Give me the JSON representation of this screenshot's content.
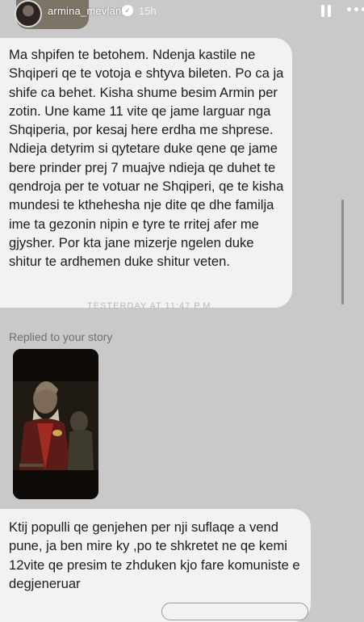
{
  "header": {
    "username": "armina_mevlani",
    "verified_mark": "✓",
    "time": "15h",
    "pause_icon": "pause-icon",
    "more_icon": "more-icon"
  },
  "messages": [
    {
      "text": "Ma shpifen te betohem. Ndenja kastile ne Shqiperi qe te votoja e shtyva bileten. Po ca ja shife ca behet. Kisha shume besim Armin per zotin. Une kame 11 vite qe jame larguar nga Shqiperia, por kesaj here erdha me shprese. Ndieja detyrim si qytetare duke qene qe jame bere prinder prej 7 muajve ndieja qe duhet te qendroja per te votuar ne Shqiperi, qe te kisha mundesi te kthehesha nje dite qe dhe familja ime ta gezonin nipin e tyre te rritej afer me gjysher. Por kta jane mizerje ngelen duke shitur te ardhemen duke shitur veten."
    },
    {
      "text": "Ktij populli qe genjehen per nji suflaqe  a vend pune, ja ben mire ky  ,po te shkretet ne qe kemi 12vite qe presim te zhduken kjo fare komuniste e degjeneruar"
    }
  ],
  "faded_text": "TESTERDAY AT 11:47 P.M.",
  "replied_label": "Replied to your story",
  "story_thumbnail": "story-image"
}
